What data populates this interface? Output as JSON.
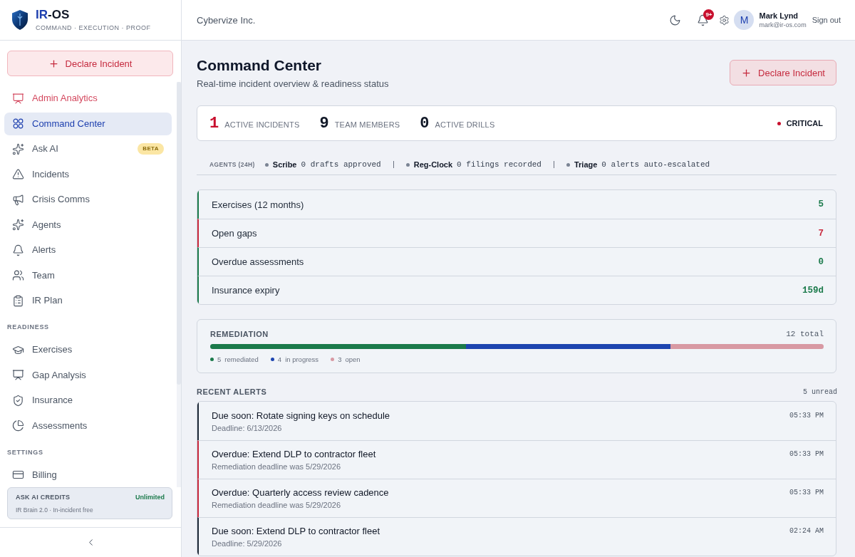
{
  "sidebar": {
    "brand": {
      "accent": "IR",
      "rest": "-OS",
      "tagline": "COMMAND · EXECUTION · PROOF"
    },
    "declare_button": {
      "label": "Declare Incident"
    },
    "sections": [
      {
        "items": [
          {
            "label": "Admin Analytics",
            "kind": "admin",
            "selected": false
          },
          {
            "label": "Command Center",
            "kind": "page",
            "selected": true
          },
          {
            "label": "Ask AI",
            "kind": "page",
            "selected": false,
            "badge": "BETA"
          },
          {
            "label": "Incidents",
            "kind": "page",
            "selected": false
          },
          {
            "label": "Crisis Comms",
            "kind": "page",
            "selected": false
          },
          {
            "label": "Agents",
            "kind": "page",
            "selected": false
          },
          {
            "label": "Alerts",
            "kind": "page",
            "selected": false
          },
          {
            "label": "Team",
            "kind": "page",
            "selected": false
          },
          {
            "label": "IR Plan",
            "kind": "page",
            "selected": false
          }
        ]
      },
      {
        "heading": "READINESS",
        "items": [
          {
            "label": "Exercises",
            "kind": "page",
            "selected": false
          },
          {
            "label": "Gap Analysis",
            "kind": "page",
            "selected": false
          },
          {
            "label": "Insurance",
            "kind": "page",
            "selected": false
          },
          {
            "label": "Assessments",
            "kind": "page",
            "selected": false
          }
        ]
      },
      {
        "heading": "SETTINGS",
        "items": [
          {
            "label": "Billing",
            "kind": "page",
            "selected": false
          }
        ]
      }
    ],
    "credits": {
      "title": "ASK AI CREDITS",
      "value": "Unlimited",
      "note": "IR Brain 2.0 · In-incident free"
    }
  },
  "header": {
    "org": "Cybervize Inc.",
    "notification_badge": "9+",
    "user": {
      "initial": "M",
      "name": "Mark Lynd",
      "email": "mark@ir-os.com"
    },
    "sign_out": "Sign out"
  },
  "page": {
    "title": "Command Center",
    "subtitle": "Real-time incident overview & readiness status",
    "declare_button": {
      "label": "Declare Incident"
    }
  },
  "stats": {
    "items": [
      {
        "value": "1",
        "label": "ACTIVE INCIDENTS",
        "color": "#c8102e"
      },
      {
        "value": "9",
        "label": "TEAM MEMBERS",
        "color": "#111827"
      },
      {
        "value": "0",
        "label": "ACTIVE DRILLS",
        "color": "#111827"
      }
    ],
    "status": {
      "label": "CRITICAL",
      "color": "#c8102e"
    }
  },
  "agents": {
    "label": "AGENTS (24H)",
    "items": [
      {
        "name": "Scribe",
        "summary": "0 drafts approved"
      },
      {
        "name": "Reg-Clock",
        "summary": "0 filings recorded"
      },
      {
        "name": "Triage",
        "summary": "0 alerts auto-escalated"
      }
    ]
  },
  "metrics": [
    {
      "label": "Exercises (12 months)",
      "value": "5",
      "color": "#1b7a4b"
    },
    {
      "label": "Open gaps",
      "value": "7",
      "color": "#c8283c"
    },
    {
      "label": "Overdue assessments",
      "value": "0",
      "color": "#1b7a4b"
    },
    {
      "label": "Insurance expiry",
      "value": "159d",
      "color": "#1b7a4b"
    }
  ],
  "remediation": {
    "title": "REMEDIATION",
    "total": "12 total",
    "segments": [
      {
        "count": "5",
        "label": "remediated",
        "color": "#1b7a4b"
      },
      {
        "count": "4",
        "label": "in progress",
        "color": "#1d45b0"
      },
      {
        "count": "3",
        "label": "open",
        "color": "#d899a3"
      }
    ]
  },
  "recent_alerts": {
    "title": "RECENT ALERTS",
    "unread": "5 unread",
    "items": [
      {
        "kind": "due_soon",
        "title": "Due soon: Rotate signing keys on schedule",
        "detail": "Deadline: 6/13/2026",
        "time": "05:33 PM"
      },
      {
        "kind": "overdue",
        "title": "Overdue: Extend DLP to contractor fleet",
        "detail": "Remediation deadline was 5/29/2026",
        "time": "05:33 PM"
      },
      {
        "kind": "overdue",
        "title": "Overdue: Quarterly access review cadence",
        "detail": "Remediation deadline was 5/29/2026",
        "time": "05:33 PM"
      },
      {
        "kind": "due_soon",
        "title": "Due soon: Extend DLP to contractor fleet",
        "detail": "Deadline: 5/29/2026",
        "time": "02:24 AM"
      }
    ]
  }
}
